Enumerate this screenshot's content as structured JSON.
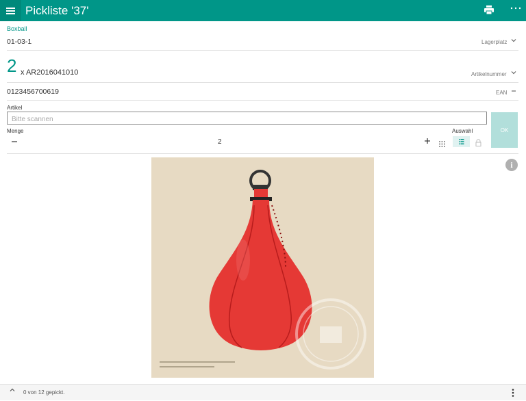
{
  "header": {
    "title": "Pickliste '37'"
  },
  "item": {
    "name": "Boxball",
    "location": "01-03-1",
    "location_label": "Lagerplatz",
    "quantity": "2",
    "article_number": "x AR2016041010",
    "article_number_label": "Artikelnummer",
    "ean": "0123456700619",
    "ean_label": "EAN"
  },
  "scan": {
    "label": "Artikel",
    "placeholder": "Bitte scannen",
    "ok_label": "OK"
  },
  "amount": {
    "label": "Menge",
    "value": "2"
  },
  "selection": {
    "label": "Auswahl"
  },
  "footer": {
    "status": "0 von 12 gepickt."
  },
  "colors": {
    "accent": "#009688",
    "accent_dark": "#00897b",
    "ok_disabled": "#b2dfdb",
    "product": "#e53935",
    "image_bg": "#e7dac3"
  }
}
